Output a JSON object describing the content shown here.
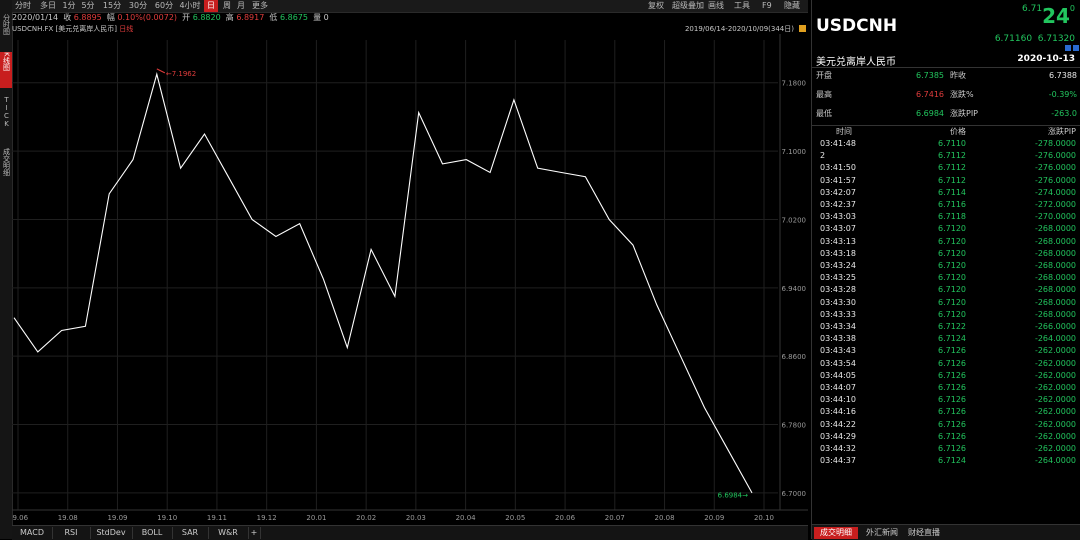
{
  "toolbar": {
    "timeframes": [
      {
        "label": "分时",
        "active": false
      },
      {
        "label": "多日",
        "active": false
      },
      {
        "label": "1分",
        "active": false
      },
      {
        "label": "5分",
        "active": false
      },
      {
        "label": "15分",
        "active": false
      },
      {
        "label": "30分",
        "active": false
      },
      {
        "label": "60分",
        "active": false
      },
      {
        "label": "4小时",
        "active": false
      },
      {
        "label": "日",
        "active": true
      },
      {
        "label": "周",
        "active": false
      },
      {
        "label": "月",
        "active": false
      },
      {
        "label": "更多",
        "active": false
      }
    ],
    "right_items": [
      "复权",
      "超级叠加",
      "画线",
      "工具",
      "F9",
      "隐藏"
    ]
  },
  "info": {
    "date": "2020/01/14",
    "close_label": "收",
    "close_value": "6.8895",
    "change_label": "幅",
    "change_value": "0.10%(0.0072)",
    "open_label": "开",
    "open_value": "6.8820",
    "high_label": "高",
    "high_value": "6.8917",
    "low_label": "低",
    "low_value": "6.8675",
    "volume_label": "量",
    "volume_value": "0"
  },
  "left_tabs": [
    {
      "label": "分时图",
      "active": false
    },
    {
      "label": "K线图",
      "active": true
    },
    {
      "label": "TICK",
      "active": false
    },
    {
      "label": "成交明细",
      "active": false
    }
  ],
  "chart_header": {
    "symbol": "USDCNH.FX",
    "name": "[美元兑离岸人民币]",
    "period": "日线",
    "range": "2019/06/14-2020/10/09(344日)"
  },
  "chart_data": {
    "type": "line",
    "x": [
      "2019-06",
      "2019-07",
      "2019-07",
      "2019-08",
      "2019-08",
      "2019-09",
      "2019-09",
      "2019-10",
      "2019-10",
      "2019-11",
      "2019-11",
      "2019-12",
      "2019-12",
      "2020-01",
      "2020-01",
      "2020-02",
      "2020-02",
      "2020-03",
      "2020-03",
      "2020-04",
      "2020-04",
      "2020-05",
      "2020-05",
      "2020-06",
      "2020-06",
      "2020-07",
      "2020-07",
      "2020-08",
      "2020-08",
      "2020-09",
      "2020-09",
      "2020-10"
    ],
    "y": [
      6.905,
      6.865,
      6.89,
      6.895,
      7.05,
      7.09,
      7.19,
      7.08,
      7.12,
      7.07,
      7.02,
      7.0,
      7.015,
      6.95,
      6.87,
      6.985,
      6.93,
      7.145,
      7.085,
      7.09,
      7.075,
      7.16,
      7.08,
      7.075,
      7.07,
      7.02,
      6.99,
      6.92,
      6.86,
      6.8,
      6.75,
      6.7
    ],
    "ylim": [
      6.68,
      7.23
    ],
    "yticks": [
      "7.1800",
      "7.1000",
      "7.0200",
      "6.9400",
      "6.8600",
      "6.7800",
      "6.7000"
    ],
    "xticks": [
      "19.06",
      "19.08",
      "19.09",
      "19.10",
      "19.11",
      "19.12",
      "20.01",
      "20.02",
      "20.03",
      "20.04",
      "20.05",
      "20.06",
      "20.07",
      "20.08",
      "20.09",
      "20.10"
    ],
    "annotations": {
      "high": "7.1962",
      "low": "6.6984"
    },
    "grid": true,
    "line_color": "#ffffff"
  },
  "indicators": [
    "MACD",
    "RSI",
    "StdDev",
    "BOLL",
    "SAR",
    "W&R",
    "+"
  ],
  "quote": {
    "symbol": "USDCNH",
    "price_prefix": "6.71",
    "price_big": "24",
    "price_suffix": "0",
    "bid": "6.71160",
    "ask": "6.71320",
    "name": "美元兑离岸人民币",
    "date": "2020-10-13",
    "stats": [
      {
        "l1": "开盘",
        "v1": "6.7385",
        "c1": "green",
        "l2": "昨收",
        "v2": "6.7388",
        "c2": "white"
      },
      {
        "l1": "最高",
        "v1": "6.7416",
        "c1": "red",
        "l2": "涨跌%",
        "v2": "-0.39%",
        "c2": "green"
      },
      {
        "l1": "最低",
        "v1": "6.6984",
        "c1": "green",
        "l2": "涨跌PIP",
        "v2": "-263.0",
        "c2": "green"
      }
    ]
  },
  "ticks": {
    "headers": [
      "时间",
      "价格",
      "涨跌PIP"
    ],
    "rows": [
      [
        "03:41:48",
        "6.7110",
        "-278.0000"
      ],
      [
        "2",
        "6.7112",
        "-276.0000"
      ],
      [
        "03:41:50",
        "6.7112",
        "-276.0000"
      ],
      [
        "03:41:57",
        "6.7112",
        "-276.0000"
      ],
      [
        "03:42:07",
        "6.7114",
        "-274.0000"
      ],
      [
        "03:42:37",
        "6.7116",
        "-272.0000"
      ],
      [
        "03:43:03",
        "6.7118",
        "-270.0000"
      ],
      [
        "03:43:07",
        "6.7120",
        "-268.0000"
      ],
      [
        "03:43:13",
        "6.7120",
        "-268.0000"
      ],
      [
        "03:43:18",
        "6.7120",
        "-268.0000"
      ],
      [
        "03:43:24",
        "6.7120",
        "-268.0000"
      ],
      [
        "03:43:25",
        "6.7120",
        "-268.0000"
      ],
      [
        "03:43:28",
        "6.7120",
        "-268.0000"
      ],
      [
        "03:43:30",
        "6.7120",
        "-268.0000"
      ],
      [
        "03:43:33",
        "6.7120",
        "-268.0000"
      ],
      [
        "03:43:34",
        "6.7122",
        "-266.0000"
      ],
      [
        "03:43:38",
        "6.7124",
        "-264.0000"
      ],
      [
        "03:43:43",
        "6.7126",
        "-262.0000"
      ],
      [
        "03:43:54",
        "6.7126",
        "-262.0000"
      ],
      [
        "03:44:05",
        "6.7126",
        "-262.0000"
      ],
      [
        "03:44:07",
        "6.7126",
        "-262.0000"
      ],
      [
        "03:44:10",
        "6.7126",
        "-262.0000"
      ],
      [
        "03:44:16",
        "6.7126",
        "-262.0000"
      ],
      [
        "03:44:22",
        "6.7126",
        "-262.0000"
      ],
      [
        "03:44:29",
        "6.7126",
        "-262.0000"
      ],
      [
        "03:44:32",
        "6.7126",
        "-262.0000"
      ],
      [
        "03:44:37",
        "6.7124",
        "-264.0000"
      ]
    ]
  },
  "bottom_tabs": [
    {
      "label": "成交明细",
      "active": true
    },
    {
      "label": "外汇新闻",
      "active": false
    },
    {
      "label": "财经直播",
      "active": false
    }
  ],
  "colors": {
    "accent": "#c81e1e",
    "up": "#e03c3c",
    "down": "#22c55e"
  }
}
